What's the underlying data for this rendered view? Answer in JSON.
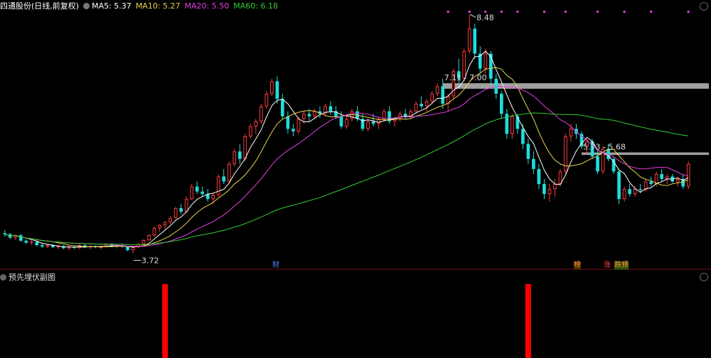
{
  "header": {
    "stock_name": "四通股份",
    "period_label": "(日线,前复权)",
    "ma": [
      {
        "label": "MA5: 5.37",
        "color": "#ffffff"
      },
      {
        "label": "MA10: 5.27",
        "color": "#e8d44d"
      },
      {
        "label": "MA20: 5.50",
        "color": "#e040e0"
      },
      {
        "label": "MA60: 6.18",
        "color": "#33cc33"
      }
    ]
  },
  "sub_panel": {
    "title": "预先埋伏副图"
  },
  "badges": [
    {
      "label": "财",
      "color": "#4a8cff"
    },
    {
      "label": "榜",
      "color": "#ff9a2e"
    },
    {
      "label": "涨",
      "color": "#ff4040"
    },
    {
      "label": "跌预",
      "color": "#ff9a2e",
      "bg": "#2a4a10"
    }
  ],
  "colors": {
    "up": "#ff3b3b",
    "down": "#1fdcdc",
    "ma5": "#ffffff",
    "ma10": "#e8d44d",
    "ma20": "#e040e0",
    "ma60": "#33cc33",
    "signal": "#ff0000",
    "zone": "#a0a0a0"
  },
  "chart_data": {
    "type": "candlestick",
    "y_range": [
      3.5,
      8.6
    ],
    "annotations": {
      "high": "8.48",
      "low": "3.72",
      "zone1": "7.11 - 7.00",
      "zone2": "5.73 - 5.68"
    },
    "price_zones": [
      {
        "top": 7.11,
        "bottom": 7.0
      },
      {
        "top": 5.73,
        "bottom": 5.68
      }
    ],
    "ohlc": [
      [
        4.12,
        4.18,
        4.05,
        4.1
      ],
      [
        4.1,
        4.12,
        4.0,
        4.03
      ],
      [
        4.03,
        4.1,
        3.98,
        4.08
      ],
      [
        4.08,
        4.1,
        3.95,
        3.97
      ],
      [
        3.97,
        4.0,
        3.9,
        3.93
      ],
      [
        3.93,
        3.98,
        3.88,
        3.95
      ],
      [
        3.95,
        3.97,
        3.86,
        3.88
      ],
      [
        3.88,
        3.92,
        3.83,
        3.85
      ],
      [
        3.85,
        3.9,
        3.82,
        3.88
      ],
      [
        3.88,
        3.9,
        3.82,
        3.84
      ],
      [
        3.84,
        3.88,
        3.8,
        3.86
      ],
      [
        3.86,
        3.88,
        3.8,
        3.82
      ],
      [
        3.82,
        3.86,
        3.78,
        3.84
      ],
      [
        3.84,
        3.86,
        3.8,
        3.83
      ],
      [
        3.83,
        3.9,
        3.8,
        3.88
      ],
      [
        3.88,
        3.9,
        3.82,
        3.84
      ],
      [
        3.84,
        3.88,
        3.8,
        3.86
      ],
      [
        3.86,
        3.88,
        3.82,
        3.84
      ],
      [
        3.84,
        3.87,
        3.8,
        3.85
      ],
      [
        3.85,
        3.92,
        3.83,
        3.9
      ],
      [
        3.9,
        3.92,
        3.84,
        3.86
      ],
      [
        3.86,
        3.9,
        3.82,
        3.88
      ],
      [
        3.88,
        3.92,
        3.83,
        3.85
      ],
      [
        3.85,
        3.86,
        3.76,
        3.78
      ],
      [
        3.78,
        3.86,
        3.72,
        3.84
      ],
      [
        3.84,
        3.92,
        3.82,
        3.9
      ],
      [
        3.9,
        4.0,
        3.88,
        3.98
      ],
      [
        3.98,
        4.1,
        3.96,
        4.08
      ],
      [
        4.08,
        4.25,
        4.05,
        4.22
      ],
      [
        4.22,
        4.3,
        4.15,
        4.28
      ],
      [
        4.28,
        4.36,
        4.2,
        4.34
      ],
      [
        4.34,
        4.45,
        4.3,
        4.42
      ],
      [
        4.42,
        4.65,
        4.4,
        4.62
      ],
      [
        4.62,
        4.7,
        4.5,
        4.55
      ],
      [
        4.55,
        4.85,
        4.52,
        4.8
      ],
      [
        4.8,
        5.1,
        4.78,
        5.05
      ],
      [
        5.05,
        5.15,
        4.9,
        4.95
      ],
      [
        4.95,
        5.05,
        4.85,
        4.9
      ],
      [
        4.9,
        5.0,
        4.75,
        4.8
      ],
      [
        4.8,
        4.92,
        4.7,
        4.88
      ],
      [
        4.88,
        5.3,
        4.85,
        5.25
      ],
      [
        5.25,
        5.4,
        5.1,
        5.15
      ],
      [
        5.15,
        5.55,
        5.12,
        5.5
      ],
      [
        5.5,
        5.8,
        5.45,
        5.75
      ],
      [
        5.75,
        5.9,
        5.5,
        5.6
      ],
      [
        5.6,
        6.1,
        5.55,
        6.05
      ],
      [
        6.05,
        6.3,
        6.0,
        6.25
      ],
      [
        6.25,
        6.4,
        6.1,
        6.35
      ],
      [
        6.35,
        6.7,
        6.3,
        6.65
      ],
      [
        6.65,
        6.95,
        6.6,
        6.9
      ],
      [
        6.9,
        7.2,
        6.85,
        7.15
      ],
      [
        7.15,
        7.25,
        6.7,
        6.8
      ],
      [
        6.8,
        6.9,
        6.4,
        6.45
      ],
      [
        6.45,
        6.55,
        6.1,
        6.2
      ],
      [
        6.2,
        6.3,
        6.05,
        6.15
      ],
      [
        6.15,
        6.45,
        6.1,
        6.4
      ],
      [
        6.4,
        6.55,
        6.3,
        6.5
      ],
      [
        6.5,
        6.6,
        6.35,
        6.45
      ],
      [
        6.45,
        6.6,
        6.4,
        6.55
      ],
      [
        6.55,
        6.65,
        6.42,
        6.5
      ],
      [
        6.5,
        6.7,
        6.45,
        6.65
      ],
      [
        6.65,
        6.75,
        6.48,
        6.55
      ],
      [
        6.55,
        6.65,
        6.4,
        6.45
      ],
      [
        6.45,
        6.55,
        6.2,
        6.25
      ],
      [
        6.25,
        6.45,
        6.2,
        6.4
      ],
      [
        6.4,
        6.6,
        6.35,
        6.55
      ],
      [
        6.55,
        6.65,
        6.35,
        6.4
      ],
      [
        6.4,
        6.5,
        6.15,
        6.2
      ],
      [
        6.2,
        6.4,
        6.15,
        6.35
      ],
      [
        6.35,
        6.5,
        6.25,
        6.3
      ],
      [
        6.3,
        6.45,
        6.2,
        6.4
      ],
      [
        6.4,
        6.6,
        6.35,
        6.55
      ],
      [
        6.55,
        6.65,
        6.3,
        6.35
      ],
      [
        6.35,
        6.45,
        6.25,
        6.4
      ],
      [
        6.4,
        6.55,
        6.35,
        6.5
      ],
      [
        6.5,
        6.6,
        6.4,
        6.45
      ],
      [
        6.45,
        6.6,
        6.4,
        6.55
      ],
      [
        6.55,
        6.75,
        6.5,
        6.7
      ],
      [
        6.7,
        6.85,
        6.6,
        6.65
      ],
      [
        6.65,
        6.8,
        6.55,
        6.75
      ],
      [
        6.75,
        6.95,
        6.7,
        6.9
      ],
      [
        6.9,
        7.1,
        6.85,
        7.05
      ],
      [
        7.05,
        7.2,
        6.6,
        6.7
      ],
      [
        6.7,
        6.9,
        6.55,
        6.85
      ],
      [
        6.85,
        7.4,
        6.8,
        7.35
      ],
      [
        7.35,
        7.6,
        7.1,
        7.2
      ],
      [
        7.2,
        7.8,
        7.15,
        7.75
      ],
      [
        7.75,
        8.48,
        7.7,
        8.2
      ],
      [
        8.2,
        8.3,
        7.6,
        7.7
      ],
      [
        7.7,
        7.85,
        7.3,
        7.4
      ],
      [
        7.4,
        7.8,
        7.3,
        7.7
      ],
      [
        7.7,
        7.75,
        7.1,
        7.2
      ],
      [
        7.2,
        7.3,
        6.8,
        6.9
      ],
      [
        6.9,
        6.95,
        6.4,
        6.5
      ],
      [
        6.5,
        6.6,
        6.0,
        6.1
      ],
      [
        6.1,
        6.5,
        6.0,
        6.45
      ],
      [
        6.45,
        6.5,
        6.1,
        6.2
      ],
      [
        6.2,
        6.3,
        5.8,
        5.9
      ],
      [
        5.9,
        6.0,
        5.5,
        5.6
      ],
      [
        5.6,
        5.75,
        5.3,
        5.4
      ],
      [
        5.4,
        5.5,
        5.0,
        5.1
      ],
      [
        5.1,
        5.2,
        4.8,
        4.9
      ],
      [
        4.9,
        5.1,
        4.75,
        5.0
      ],
      [
        5.0,
        5.2,
        4.85,
        5.1
      ],
      [
        5.1,
        5.4,
        5.05,
        5.35
      ],
      [
        5.35,
        6.1,
        5.3,
        6.05
      ],
      [
        6.05,
        6.3,
        5.95,
        6.2
      ],
      [
        6.2,
        6.3,
        6.0,
        6.1
      ],
      [
        6.1,
        6.15,
        5.8,
        5.85
      ],
      [
        5.85,
        6.0,
        5.7,
        5.95
      ],
      [
        5.95,
        6.0,
        5.6,
        5.65
      ],
      [
        5.65,
        5.8,
        5.3,
        5.35
      ],
      [
        5.35,
        5.85,
        5.3,
        5.8
      ],
      [
        5.8,
        5.9,
        5.55,
        5.6
      ],
      [
        5.6,
        5.65,
        5.3,
        5.35
      ],
      [
        5.35,
        5.4,
        4.7,
        4.8
      ],
      [
        4.8,
        5.05,
        4.75,
        5.0
      ],
      [
        5.0,
        5.1,
        4.85,
        4.9
      ],
      [
        4.9,
        5.05,
        4.85,
        5.0
      ],
      [
        5.0,
        5.1,
        4.92,
        4.98
      ],
      [
        4.98,
        5.2,
        4.95,
        5.15
      ],
      [
        5.15,
        5.25,
        5.05,
        5.1
      ],
      [
        5.1,
        5.35,
        5.05,
        5.3
      ],
      [
        5.3,
        5.4,
        5.15,
        5.2
      ],
      [
        5.2,
        5.3,
        5.1,
        5.25
      ],
      [
        5.25,
        5.3,
        5.12,
        5.15
      ],
      [
        5.15,
        5.25,
        5.05,
        5.2
      ],
      [
        5.2,
        5.3,
        5.0,
        5.05
      ],
      [
        5.05,
        5.55,
        5.0,
        5.5
      ]
    ],
    "signals": [
      30,
      98
    ]
  }
}
